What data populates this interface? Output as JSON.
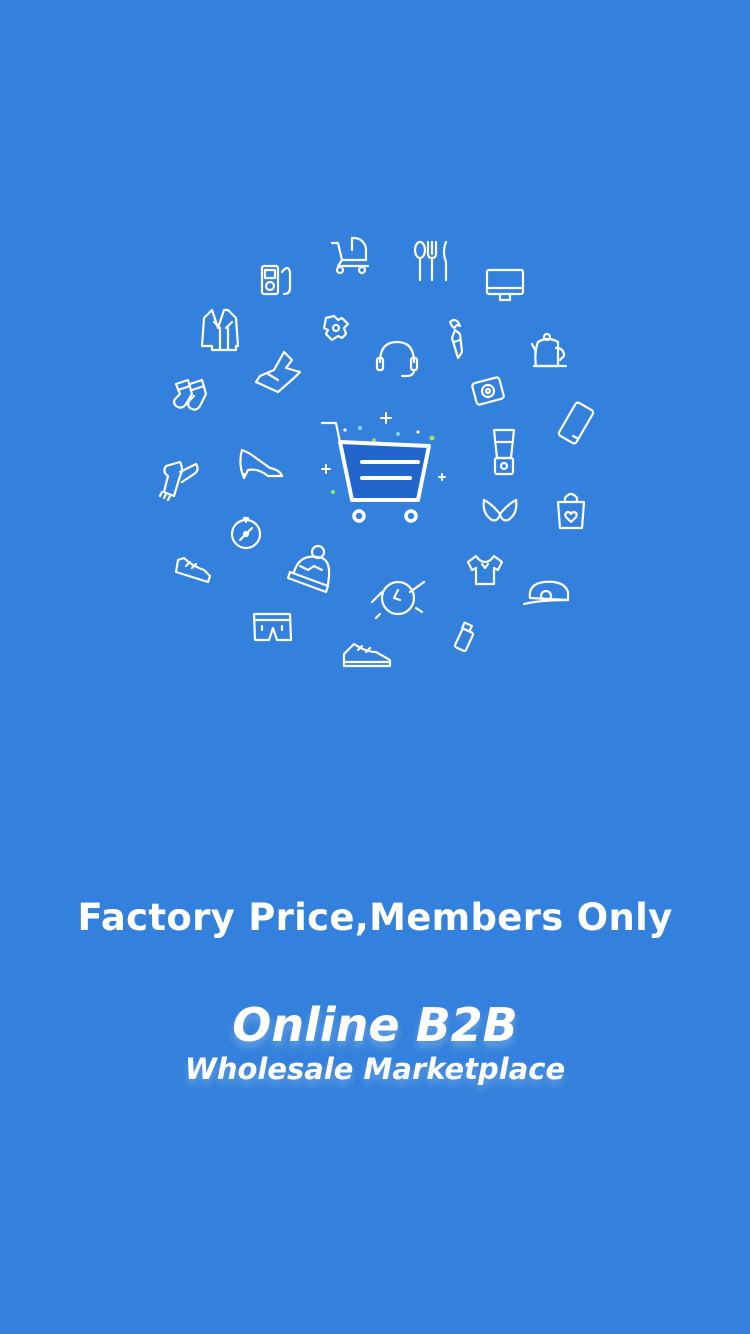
{
  "splash": {
    "tagline": "Factory Price,Members Only",
    "brand_title": "Online B2B",
    "brand_subtitle": "Wholesale Marketplace"
  },
  "colors": {
    "background": "#3381dc",
    "icon_stroke": "#ffffff",
    "cart_fill": "#2266cc",
    "sparkle_green": "#a8e063",
    "sparkle_blue": "#8fd0ff"
  },
  "illustration": {
    "center_icon": "shopping-cart-icon",
    "icons": [
      "stroller-icon",
      "cutlery-icon",
      "mp3-player-icon",
      "monitor-icon",
      "jacket-icon",
      "baby-onesie-icon",
      "wrench-tie-icon",
      "kettle-icon",
      "headset-icon",
      "dress-icon",
      "socks-icon",
      "camera-icon",
      "smartphone-icon",
      "blender-icon",
      "scarf-icon",
      "high-heel-icon",
      "bra-icon",
      "shopping-bag-icon",
      "compass-icon",
      "sneaker-icon",
      "beanie-icon",
      "tshirt-icon",
      "cap-icon",
      "wristwatch-icon",
      "shorts-icon",
      "usb-drive-icon",
      "running-shoe-icon"
    ]
  }
}
